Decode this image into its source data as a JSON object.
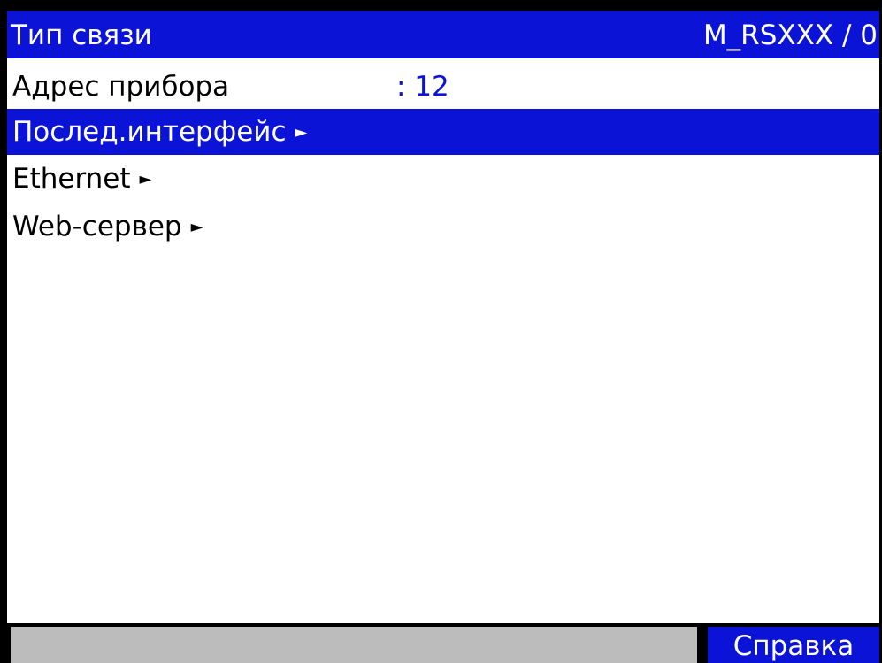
{
  "title_bar": {
    "title": "Тип связи",
    "device_id": "M_RSXXX / 0"
  },
  "menu": {
    "address": {
      "label": "Адрес прибора",
      "value": ": 12"
    },
    "items": [
      {
        "label": "Послед.интерфейс",
        "arrow": "►",
        "selected": true
      },
      {
        "label": "Ethernet",
        "arrow": "►",
        "selected": false
      },
      {
        "label": "Web-сервер",
        "arrow": "►",
        "selected": false
      }
    ]
  },
  "status_bar": {
    "status_text": "",
    "help_label": "Справка"
  },
  "colors": {
    "accent": "#0b14d6",
    "background": "#ffffff",
    "status_field": "#bcbcbc",
    "frame": "#000000"
  }
}
